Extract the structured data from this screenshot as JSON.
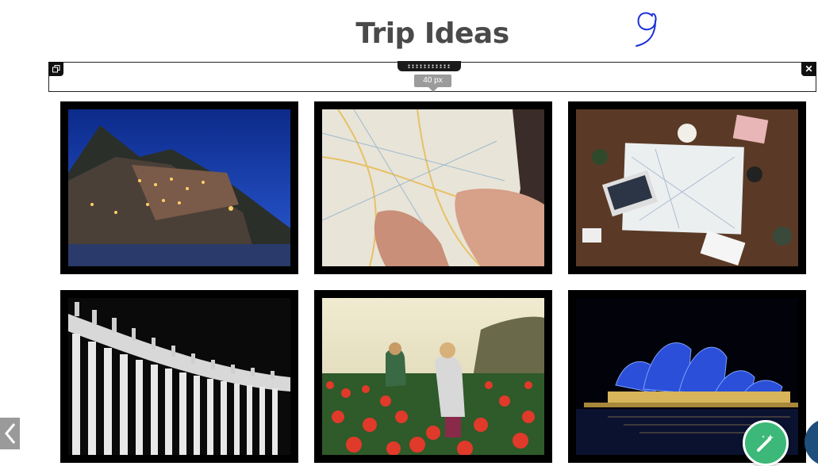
{
  "page": {
    "title": "Trip Ideas"
  },
  "spacer": {
    "height_label": "40 px"
  },
  "gallery": {
    "photos": [
      {
        "subject": "coastal-village-at-night"
      },
      {
        "subject": "hands-holding-map"
      },
      {
        "subject": "map-laptop-on-desk"
      },
      {
        "subject": "colonnade-statues-bw"
      },
      {
        "subject": "children-in-tulip-field"
      },
      {
        "subject": "opera-house-at-night"
      }
    ]
  },
  "icons": {
    "duplicate": "duplicate-icon",
    "close": "close-icon",
    "drag": "drag-handle-icon",
    "prev": "chevron-left-icon",
    "magic": "magic-wand-icon"
  },
  "colors": {
    "title": "#4a4a4a",
    "frame": "#000000",
    "magic_button": "#3cb878",
    "edge_circle": "#1e4f7c",
    "tooltip": "#9b9b9b"
  }
}
